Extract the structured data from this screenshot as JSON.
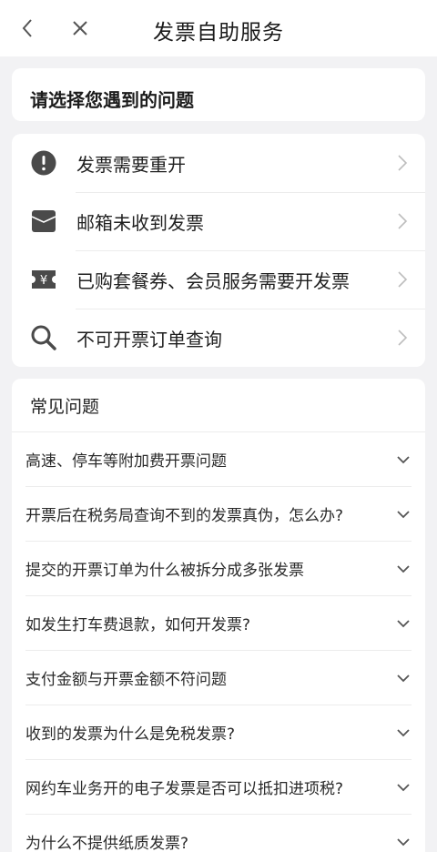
{
  "header": {
    "title": "发票自助服务",
    "back_icon": "chevron-left-icon",
    "close_icon": "close-icon"
  },
  "prompt": {
    "text": "请选择您遇到的问题"
  },
  "options": [
    {
      "label": "发票需要重开",
      "icon": "exclamation-circle-icon"
    },
    {
      "label": "邮箱未收到发票",
      "icon": "envelope-icon"
    },
    {
      "label": "已购套餐券、会员服务需要开发票",
      "icon": "yuan-ticket-icon"
    },
    {
      "label": "不可开票订单查询",
      "icon": "search-icon"
    }
  ],
  "faq": {
    "title": "常见问题",
    "items": [
      "高速、停车等附加费开票问题",
      "开票后在税务局查询不到的发票真伪，怎么办?",
      "提交的开票订单为什么被拆分成多张发票",
      "如发生打车费退款，如何开发票?",
      "支付金额与开票金额不符问题",
      "收到的发票为什么是免税发票?",
      "网约车业务开的电子发票是否可以抵扣进项税?",
      "为什么不提供纸质发票?"
    ]
  },
  "colors": {
    "background": "#f2f2f4",
    "card": "#ffffff",
    "icon": "#4a4a4a",
    "chevron": "#bdbdbd"
  }
}
